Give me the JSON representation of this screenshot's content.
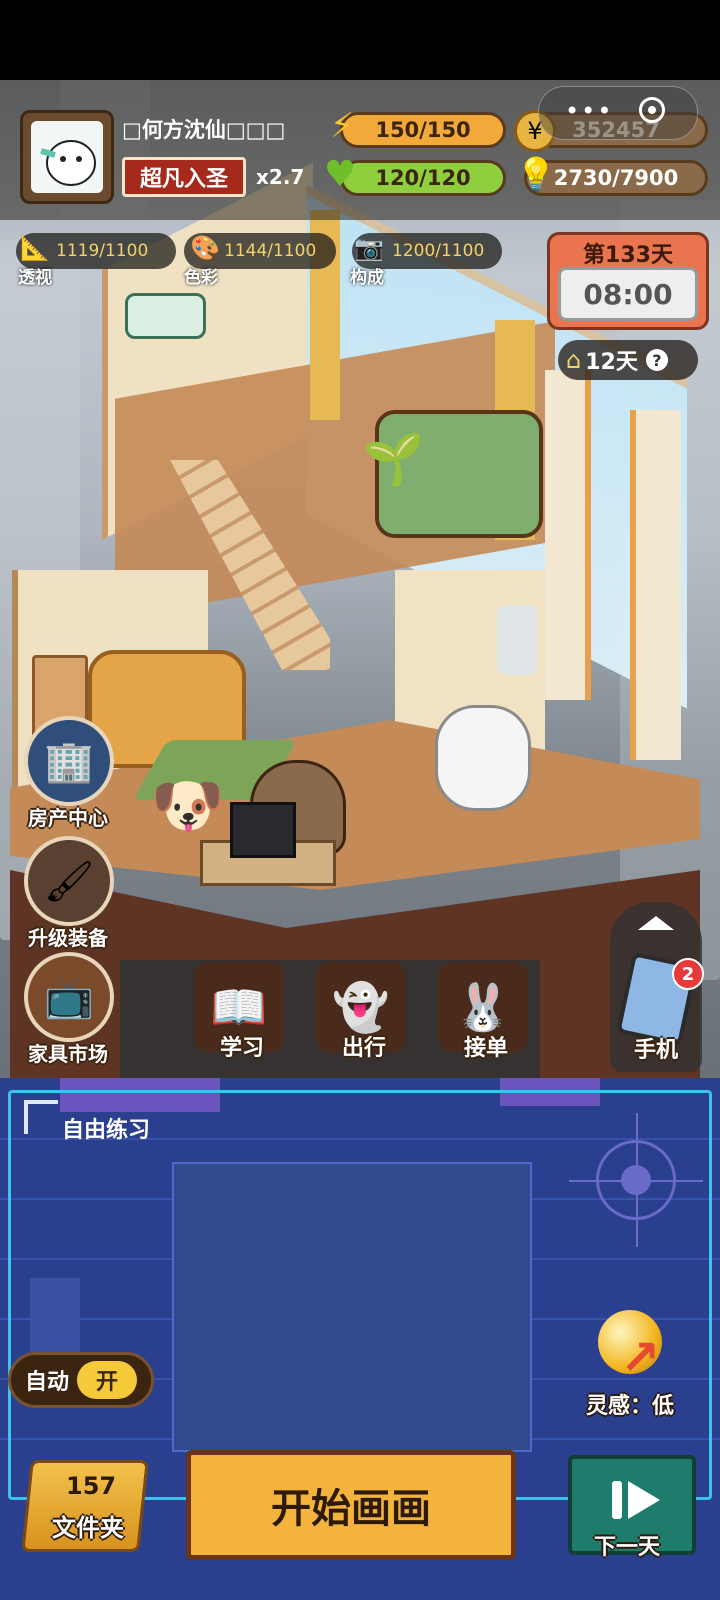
{
  "player": {
    "name": "□何方沈仙□□□",
    "rank": "超凡入圣",
    "multiplier": "x2.7"
  },
  "stats": {
    "energy": "150/150",
    "coins": "352457",
    "health": "120/120",
    "inspiration_points": "2730/7900"
  },
  "skills": [
    {
      "label": "透视",
      "value": "1119/1100",
      "icon": "ruler-icon"
    },
    {
      "label": "色彩",
      "value": "1144/1100",
      "icon": "palette-icon"
    },
    {
      "label": "构成",
      "value": "1200/1100",
      "icon": "camera-icon"
    }
  ],
  "calendar": {
    "day": "第133天",
    "time": "08:00"
  },
  "rent": {
    "days": "12天",
    "help": "?"
  },
  "side_menu": [
    {
      "label": "房产中心",
      "icon": "building-icon"
    },
    {
      "label": "升级装备",
      "icon": "paintbrush-icon"
    },
    {
      "label": "家具市场",
      "icon": "furniture-icon"
    }
  ],
  "actions": [
    {
      "label": "学习",
      "icon": "book-icon"
    },
    {
      "label": "出行",
      "icon": "ghost-icon"
    },
    {
      "label": "接单",
      "icon": "rabbit-icon"
    }
  ],
  "phone": {
    "label": "手机",
    "badge": "2"
  },
  "panel": {
    "mode": "自由练习",
    "inspiration_label": "灵感：低",
    "auto_label": "自动",
    "auto_state": "开",
    "folder_count": "157",
    "folder_label": "文件夹",
    "start_label": "开始画画",
    "next_label": "下一天"
  },
  "colors": {
    "energy": "#f3a93a",
    "health": "#8fcf3e",
    "coins": "#8a6a48",
    "panel": "#2b3f8f",
    "accent": "#3ec1ea"
  }
}
